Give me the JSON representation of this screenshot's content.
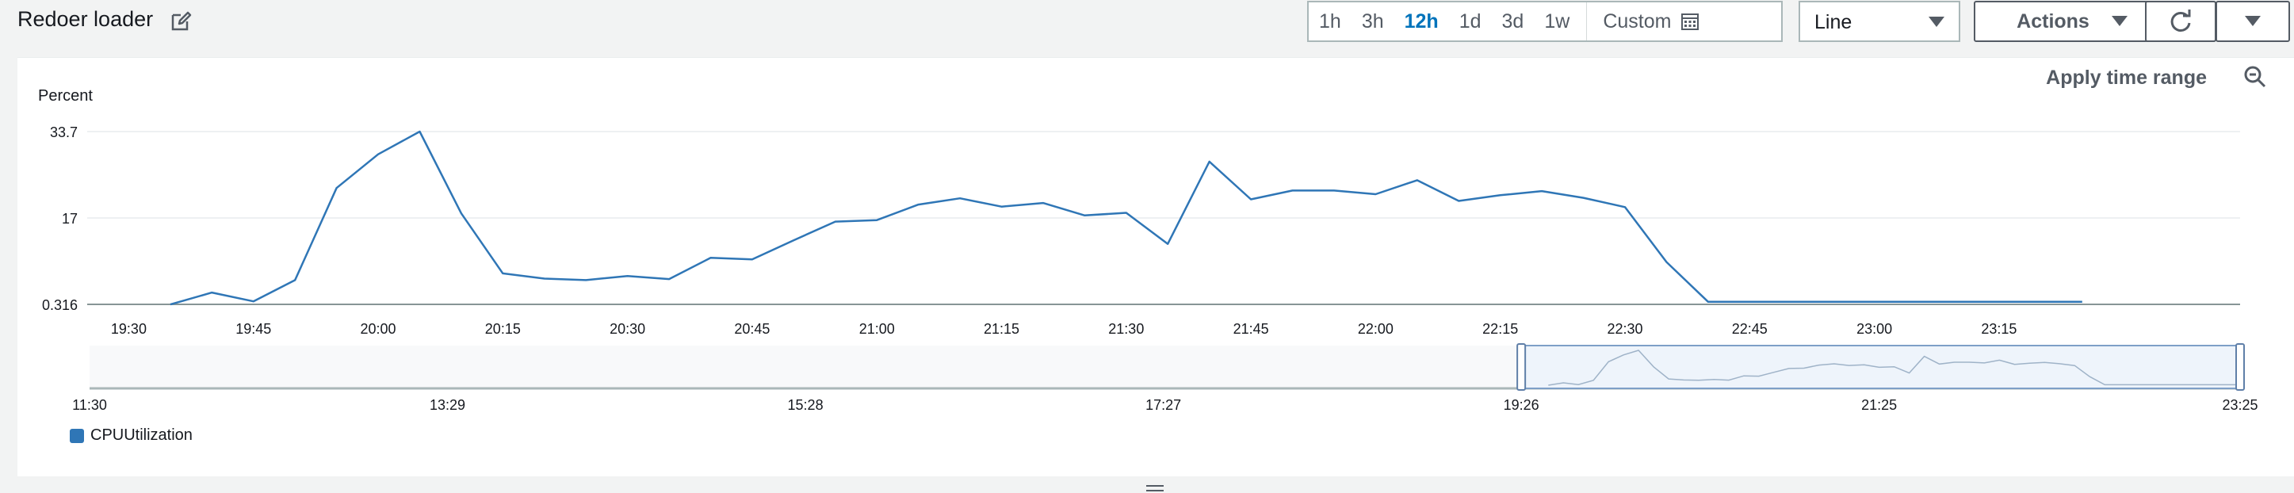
{
  "widget": {
    "title": "Redoer loader"
  },
  "time_range": {
    "options": [
      "1h",
      "3h",
      "12h",
      "1d",
      "3d",
      "1w"
    ],
    "active": "12h",
    "custom_label": "Custom"
  },
  "chart_type_select": {
    "value": "Line"
  },
  "actions": {
    "label": "Actions"
  },
  "panel": {
    "apply_time_range": "Apply time range"
  },
  "colors": {
    "series": "#2f76b6",
    "active_range": "#0073bb"
  },
  "chart_data": {
    "type": "line",
    "ylabel": "Percent",
    "ylim": [
      0.316,
      33.7
    ],
    "yticks": [
      "0.316",
      "17",
      "33.7"
    ],
    "xticks": [
      "19:30",
      "19:45",
      "20:00",
      "20:15",
      "20:30",
      "20:45",
      "21:00",
      "21:15",
      "21:30",
      "21:45",
      "22:00",
      "22:15",
      "22:30",
      "22:45",
      "23:00",
      "23:15"
    ],
    "x": [
      "19:35",
      "19:40",
      "19:45",
      "19:50",
      "19:55",
      "20:00",
      "20:05",
      "20:10",
      "20:15",
      "20:20",
      "20:25",
      "20:30",
      "20:35",
      "20:40",
      "20:45",
      "20:50",
      "20:55",
      "21:00",
      "21:05",
      "21:10",
      "21:15",
      "21:20",
      "21:25",
      "21:30",
      "21:35",
      "21:40",
      "21:45",
      "21:50",
      "21:55",
      "22:00",
      "22:05",
      "22:10",
      "22:15",
      "22:20",
      "22:25",
      "22:30",
      "22:35",
      "22:40",
      "22:45",
      "22:50",
      "22:55",
      "23:00",
      "23:05",
      "23:10",
      "23:15",
      "23:20",
      "23:25"
    ],
    "series": [
      {
        "name": "CPUUtilization",
        "values": [
          0.3,
          2.6,
          0.9,
          5.0,
          22.8,
          29.3,
          33.7,
          17.9,
          6.3,
          5.3,
          5.0,
          5.8,
          5.2,
          9.3,
          9.0,
          12.7,
          16.3,
          16.6,
          19.6,
          20.8,
          19.2,
          19.9,
          17.5,
          18.0,
          12.0,
          27.9,
          20.6,
          22.3,
          22.3,
          21.6,
          24.3,
          20.3,
          21.4,
          22.2,
          20.9,
          19.1,
          8.5,
          0.8,
          0.8,
          0.8,
          0.8,
          0.8,
          0.8,
          0.8,
          0.8,
          0.8,
          0.8
        ]
      }
    ],
    "overview": {
      "ticks": [
        "11:30",
        "13:29",
        "15:28",
        "17:27",
        "19:26",
        "21:25",
        "23:25"
      ],
      "selection": [
        "19:26",
        "23:25"
      ]
    },
    "grid": true,
    "legend": "bottom-left"
  }
}
